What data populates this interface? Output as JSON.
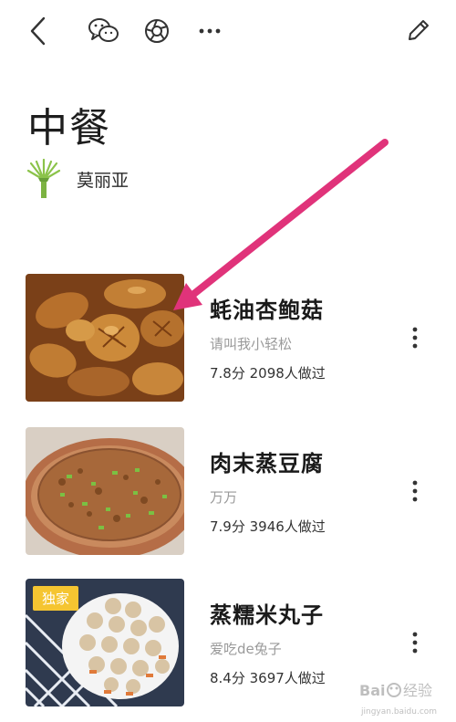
{
  "collection": {
    "title": "中餐",
    "author": {
      "name": "莫丽亚",
      "avatar": "bonsai-tree-avatar"
    }
  },
  "toolbar": {
    "icons": [
      "back-icon",
      "wechat-icon",
      "moments-icon",
      "more-icon",
      "edit-icon"
    ]
  },
  "recipes": [
    {
      "title": "蚝油杏鲍菇",
      "author": "请叫我小轻松",
      "stats": "7.8分 2098人做过",
      "badge": ""
    },
    {
      "title": "肉末蒸豆腐",
      "author": "万万",
      "stats": "7.9分 3946人做过",
      "badge": ""
    },
    {
      "title": "蒸糯米丸子",
      "author": "爱吃de兔子",
      "stats": "8.4分 3697人做过",
      "badge": "独家"
    }
  ],
  "annotation": {
    "color": "#e0337a"
  },
  "watermark": {
    "brand": "Baidu经验",
    "url": "jingyan.baidu.com"
  }
}
